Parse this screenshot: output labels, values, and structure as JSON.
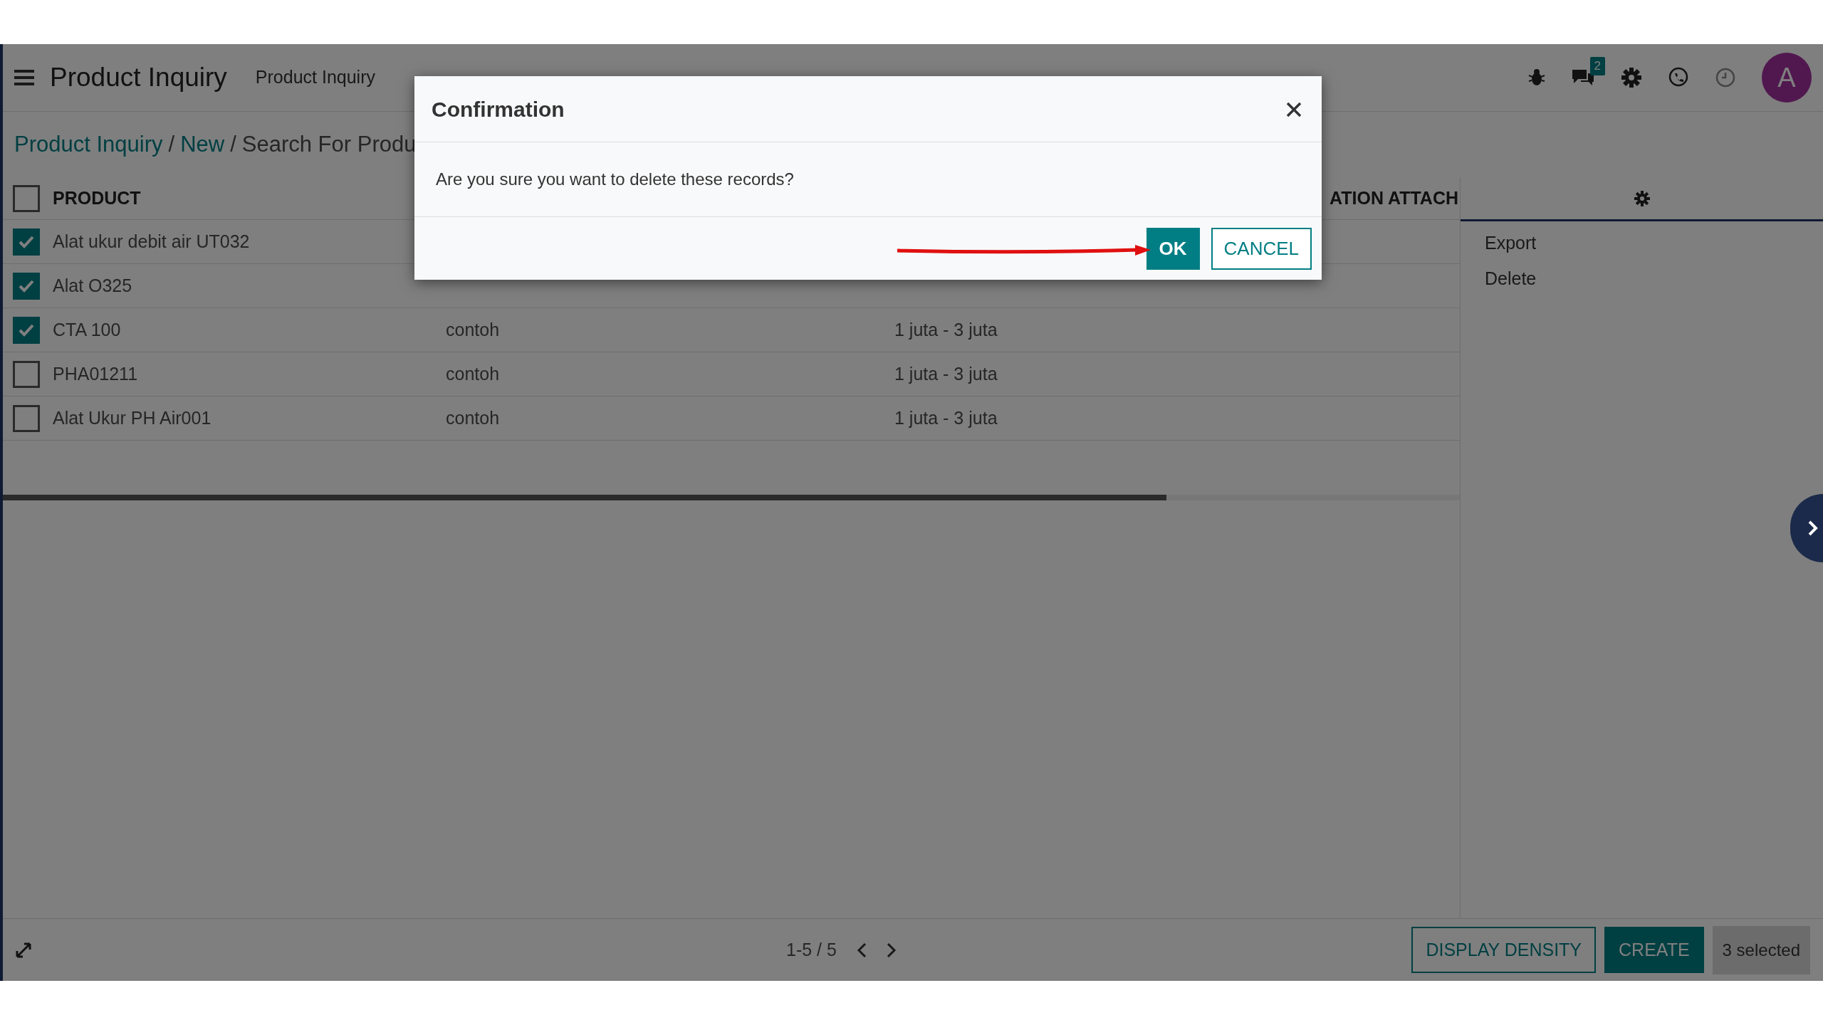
{
  "app": {
    "title": "Product Inquiry",
    "menu": [
      "Product Inquiry"
    ],
    "chat_badge": "2",
    "avatar": "A"
  },
  "breadcrumb": {
    "separator": "/",
    "items": [
      {
        "text": "Product Inquiry",
        "link": true
      },
      {
        "text": "New",
        "link": true
      },
      {
        "text": "Search For Produ",
        "link": false
      }
    ]
  },
  "table": {
    "header_checked": false,
    "columns": [
      "PRODUCT",
      "ATION ATTACH"
    ],
    "rows": [
      {
        "checked": true,
        "product": "Alat ukur debit air UT032"
      },
      {
        "checked": true,
        "product": "Alat O325"
      },
      {
        "checked": true,
        "product": "CTA 100",
        "column_2": "contoh",
        "column_3": "1 juta - 3 juta"
      },
      {
        "checked": false,
        "product": "PHA01211",
        "column_2": "contoh",
        "column_3": "1 juta - 3 juta"
      },
      {
        "checked": false,
        "product": "Alat Ukur PH Air001",
        "column_2": "contoh",
        "column_3": "1 juta - 3 juta"
      }
    ]
  },
  "side_panel": {
    "items": [
      "Export",
      "Delete"
    ]
  },
  "footer": {
    "pager": "1-5 / 5",
    "buttons": [
      "DISPLAY DENSITY",
      "CREATE"
    ],
    "selection": "3 selected"
  },
  "dialog": {
    "title": "Confirmation",
    "message": "Are you sure you want to delete these records?",
    "buttons": [
      {
        "label": "OK",
        "primary": true
      },
      {
        "label": "CANCEL",
        "primary": false
      }
    ]
  }
}
